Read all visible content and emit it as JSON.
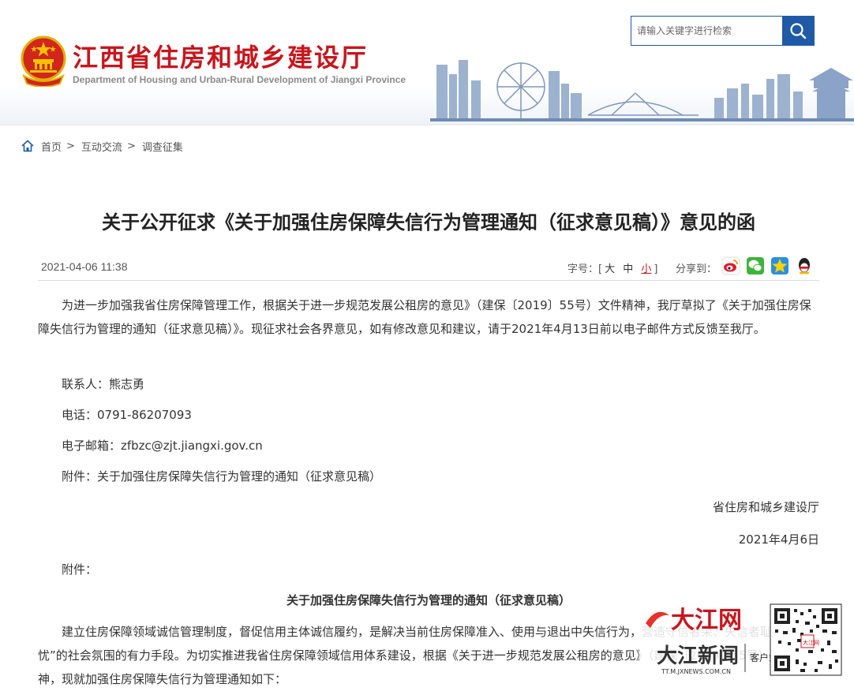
{
  "header": {
    "site_title": "江西省住房和城乡建设厅",
    "site_subtitle": "Department of Housing and Urban-Rural Development of Jiangxi Province",
    "search": {
      "placeholder": "请输入关键字进行检索",
      "button_icon": "search-icon"
    }
  },
  "breadcrumb": {
    "items": [
      "首页",
      "互动交流",
      "调查征集"
    ],
    "separator": ">"
  },
  "article": {
    "title": "关于公开征求《关于加强住房保障失信行为管理通知（征求意见稿）》意见的函",
    "date": "2021-04-06 11:38",
    "font_size": {
      "label": "字号：[",
      "large": "大",
      "medium": "中",
      "small": "小",
      "close": "]"
    },
    "share_label": "分享到：",
    "share_icons": [
      "weibo-icon",
      "wechat-icon",
      "qzone-icon",
      "qq-icon"
    ],
    "intro": "为进一步加强我省住房保障管理工作，根据关于进一步规范发展公租房的意见》（建保〔2019〕55号）文件精神，我厅草拟了《关于加强住房保障失信行为管理的通知（征求意见稿）》。现征求社会各界意见，如有修改意见和建议，请于2021年4月13日前以电子邮件方式反馈至我厅。",
    "contact": "联系人：熊志勇",
    "phone": "电话：0791-86207093",
    "email": "电子邮箱：zfbzc@zjt.jiangxi.gov.cn",
    "attachment_line": "附件：关于加强住房保障失信行为管理的通知（征求意见稿）",
    "signature_org": "省住房和城乡建设厅",
    "signature_date": "2021年4月6日",
    "attachment_label": "附件：",
    "attachment_title": "关于加强住房保障失信行为管理的通知（征求意见稿）",
    "body_text": "建立住房保障领域诚信管理制度，督促信用主体诚信履约，是解决当前住房保障准入、使用与退出中失信行为，营造守信者荣、失信者耻、无信者忧”的社会氛围的有力手段。为切实推进我省住房保障领域信用体系建设，根据《关于进一步规范发展公租房的意见》（建保〔2019〕55号）文件精神，现就加强住房保障失信行为管理通知如下："
  },
  "watermark": {
    "brand": "大江网",
    "news": "大江新闻",
    "client": "客户端",
    "url": "TT.M.JXNEWS.COM.CN"
  },
  "colors": {
    "brand_red": "#c8161d",
    "brand_blue": "#1f5aa6"
  }
}
